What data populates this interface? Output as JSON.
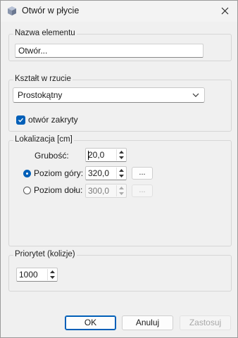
{
  "window": {
    "title": "Otwór w płycie"
  },
  "groups": {
    "name": {
      "legend": "Nazwa elementu",
      "value": "Otwór..."
    },
    "shape": {
      "legend": "Kształt w rzucie",
      "selected": "Prostokątny",
      "checkbox_label": "otwór zakryty",
      "checkbox_checked": true
    },
    "location": {
      "legend": "Lokalizacja [cm]",
      "thickness_label": "Grubość:",
      "thickness_value": "20,0",
      "top_label": "Poziom góry:",
      "top_value": "320,0",
      "top_selected": true,
      "bottom_label": "Poziom dołu:",
      "bottom_value": "300,0",
      "bottom_selected": false,
      "browse_label": "..."
    },
    "priority": {
      "legend": "Priorytet (kolizje)",
      "value": "1000"
    }
  },
  "buttons": {
    "ok": "OK",
    "cancel": "Anuluj",
    "apply": "Zastosuj"
  },
  "colors": {
    "accent": "#005fb8",
    "background": "#f0f0f0"
  }
}
